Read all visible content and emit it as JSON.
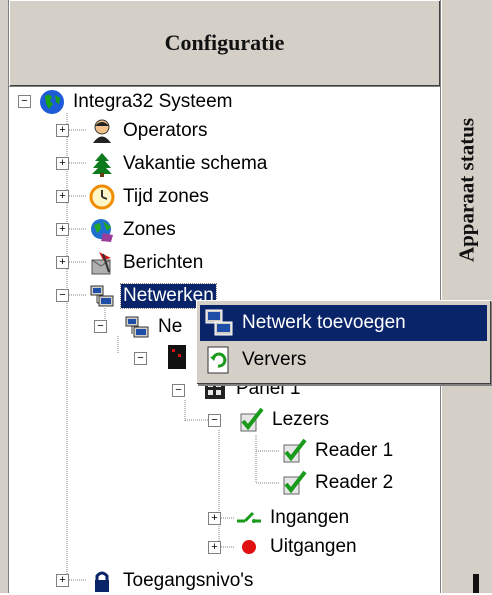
{
  "panel": {
    "title": "Configuratie"
  },
  "status_panel": {
    "title": "Apparaat status"
  },
  "tree": {
    "root": "Integra32 Systeem",
    "operators": "Operators",
    "vakantie": "Vakantie schema",
    "tijdzones": "Tijd zones",
    "zones": "Zones",
    "berichten": "Berichten",
    "netwerken": "Netwerken",
    "netwerk_child": "Ne",
    "panel": "Panel 1",
    "lezers": "Lezers",
    "reader1": "Reader 1",
    "reader2": "Reader 2",
    "ingangen": "Ingangen",
    "uitgangen": "Uitgangen",
    "toegang": "Toegangsnivo's"
  },
  "context_menu": {
    "add_network": "Netwerk toevoegen",
    "refresh": "Ververs"
  },
  "colors": {
    "selection": "#0a246a",
    "chrome": "#d4d0c8"
  }
}
